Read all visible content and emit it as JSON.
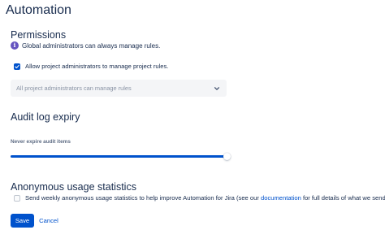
{
  "page": {
    "title": "Automation"
  },
  "permissions": {
    "heading": "Permissions",
    "info_text": "Global administrators can always manage rules.",
    "icon": "info-icon",
    "allow_checkbox": {
      "label": "Allow project administrators to manage project rules.",
      "checked": true
    },
    "select": {
      "value": "All project administrators can manage rules"
    }
  },
  "audit": {
    "heading": "Audit log expiry",
    "slider_label": "Never expire audit items",
    "slider_value": 1.0
  },
  "anonymous": {
    "heading": "Anonymous usage statistics",
    "checkbox": {
      "checked": false,
      "text_before": "Send weekly anonymous usage statistics to help improve Automation for Jira (see our",
      "link_text": "documentation",
      "text_after": "for full details of what we send)."
    }
  },
  "actions": {
    "save_label": "Save",
    "cancel_label": "Cancel"
  },
  "colors": {
    "primary": "#0052cc",
    "info": "#6554c0",
    "text": "#172b4d",
    "muted": "#8993a4"
  }
}
